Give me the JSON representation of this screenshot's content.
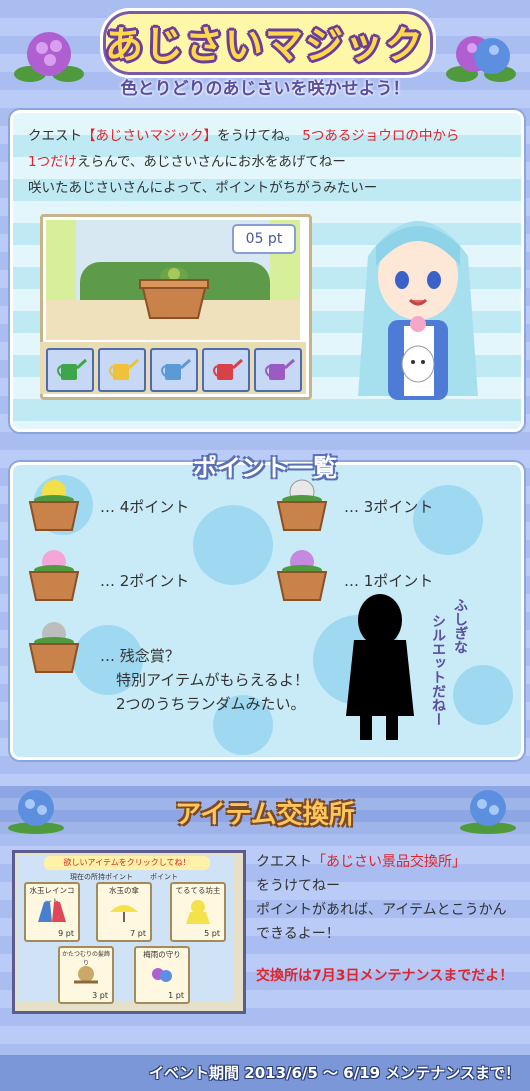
{
  "header": {
    "title": "あじさいマジック",
    "subtitle": "色とりどりのあじさいを咲かせよう！"
  },
  "intro": {
    "line1_a": "クエスト",
    "line1_b": "【あじさいマジック】",
    "line1_c": "をうけてね。",
    "line1_d": "5つあるジョウロの中から",
    "line2_a": "1つだけ",
    "line2_b": "えらんで、あじさいさんにお水をあげてねー",
    "line3": "咲いたあじさいさんによって、ポイントがちがうみたいー"
  },
  "game": {
    "points_display": "05 pt",
    "cans": [
      {
        "name": "green-can",
        "color": "#3fa54a"
      },
      {
        "name": "yellow-can",
        "color": "#f0c23a"
      },
      {
        "name": "blue-can",
        "color": "#5c9ad6"
      },
      {
        "name": "red-can",
        "color": "#d8414a"
      },
      {
        "name": "purple-can",
        "color": "#9a5cc2"
      }
    ]
  },
  "points": {
    "title": "ポイント一覧",
    "rows": [
      {
        "label": "… 4ポイント",
        "color": "#f2e04a"
      },
      {
        "label": "… 3ポイント",
        "color": "#e8e8e8"
      },
      {
        "label": "… 2ポイント",
        "color": "#f4a6d8"
      },
      {
        "label": "… 1ポイント",
        "color": "#c58ae0"
      }
    ],
    "consolation_1": "… 残念賞？",
    "consolation_2": "特別アイテムがもらえるよ！",
    "consolation_3": "2つのうちランダムみたい。",
    "consolation_color": "#bdbdbd",
    "silhouette_note_1": "ふしぎな",
    "silhouette_note_2": "シルエットだねー"
  },
  "items": {
    "title": "アイテム交換所",
    "shop_header": "欲しいアイテムをクリックしてね！",
    "current_points": "現在の所持ポイント",
    "points_col": "ポイント",
    "cards": [
      {
        "label": "水玉レインコート",
        "pt": "9 pt"
      },
      {
        "label": "水玉の傘",
        "pt": "7 pt"
      },
      {
        "label": "てるてる坊主",
        "pt": "5 pt"
      },
      {
        "label": "かたつむりの髪飾り",
        "pt": "3 pt"
      },
      {
        "label": "梅雨の守り",
        "pt": "1 pt"
      }
    ],
    "text_a": "クエスト",
    "text_b": "「あじさい景品交換所」",
    "text_c": "をうけてねー",
    "text_d": "ポイントがあれば、アイテムとこうかん",
    "text_e": "できるよー！",
    "notice": "交換所は7月3日メンテナンスまでだよ！"
  },
  "footer": {
    "text": "イベント期間 2013/6/5 ～ 6/19 メンテナンスまで！"
  },
  "colors": {
    "accent_red": "#e0242d",
    "title_yellow": "#ffd84a",
    "title_outline": "#6b3f98"
  }
}
